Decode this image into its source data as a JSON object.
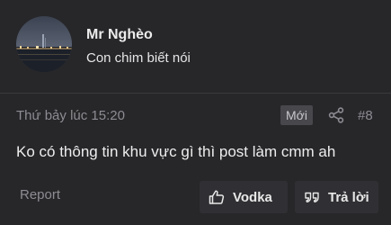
{
  "author": {
    "name": "Mr Nghèo",
    "title": "Con chim biết nói"
  },
  "meta": {
    "timestamp": "Thứ bảy lúc 15:20",
    "badge": "Mới",
    "post_number": "#8"
  },
  "message": "Ko có thông tin khu vực gì thì post làm cmm ah",
  "actions": {
    "report_label": "Report",
    "like_label": "Vodka",
    "reply_label": "Trả lời"
  },
  "icons": {
    "share": "share-icon",
    "like": "thumbs-up-icon",
    "reply": "quote-icon"
  },
  "colors": {
    "background": "#27272a",
    "button_bg": "#303034",
    "badge_bg": "#47474c",
    "muted_text": "#8c8c92"
  }
}
